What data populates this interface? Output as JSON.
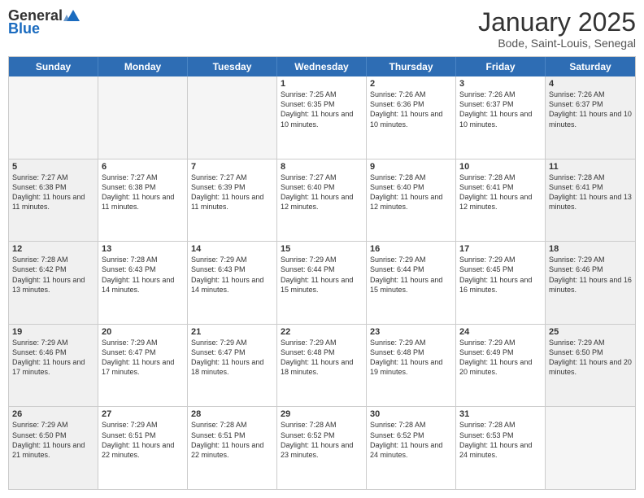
{
  "header": {
    "logo_general": "General",
    "logo_blue": "Blue",
    "month_title": "January 2025",
    "location": "Bode, Saint-Louis, Senegal"
  },
  "days_of_week": [
    "Sunday",
    "Monday",
    "Tuesday",
    "Wednesday",
    "Thursday",
    "Friday",
    "Saturday"
  ],
  "weeks": [
    [
      {
        "day": "",
        "empty": true
      },
      {
        "day": "",
        "empty": true
      },
      {
        "day": "",
        "empty": true
      },
      {
        "day": "1",
        "sunrise": "7:25 AM",
        "sunset": "6:35 PM",
        "daylight": "11 hours and 10 minutes."
      },
      {
        "day": "2",
        "sunrise": "7:26 AM",
        "sunset": "6:36 PM",
        "daylight": "11 hours and 10 minutes."
      },
      {
        "day": "3",
        "sunrise": "7:26 AM",
        "sunset": "6:37 PM",
        "daylight": "11 hours and 10 minutes."
      },
      {
        "day": "4",
        "sunrise": "7:26 AM",
        "sunset": "6:37 PM",
        "daylight": "11 hours and 10 minutes.",
        "shaded": true
      }
    ],
    [
      {
        "day": "5",
        "sunrise": "7:27 AM",
        "sunset": "6:38 PM",
        "daylight": "11 hours and 11 minutes.",
        "shaded": true
      },
      {
        "day": "6",
        "sunrise": "7:27 AM",
        "sunset": "6:38 PM",
        "daylight": "11 hours and 11 minutes."
      },
      {
        "day": "7",
        "sunrise": "7:27 AM",
        "sunset": "6:39 PM",
        "daylight": "11 hours and 11 minutes."
      },
      {
        "day": "8",
        "sunrise": "7:27 AM",
        "sunset": "6:40 PM",
        "daylight": "11 hours and 12 minutes."
      },
      {
        "day": "9",
        "sunrise": "7:28 AM",
        "sunset": "6:40 PM",
        "daylight": "11 hours and 12 minutes."
      },
      {
        "day": "10",
        "sunrise": "7:28 AM",
        "sunset": "6:41 PM",
        "daylight": "11 hours and 12 minutes."
      },
      {
        "day": "11",
        "sunrise": "7:28 AM",
        "sunset": "6:41 PM",
        "daylight": "11 hours and 13 minutes.",
        "shaded": true
      }
    ],
    [
      {
        "day": "12",
        "sunrise": "7:28 AM",
        "sunset": "6:42 PM",
        "daylight": "11 hours and 13 minutes.",
        "shaded": true
      },
      {
        "day": "13",
        "sunrise": "7:28 AM",
        "sunset": "6:43 PM",
        "daylight": "11 hours and 14 minutes."
      },
      {
        "day": "14",
        "sunrise": "7:29 AM",
        "sunset": "6:43 PM",
        "daylight": "11 hours and 14 minutes."
      },
      {
        "day": "15",
        "sunrise": "7:29 AM",
        "sunset": "6:44 PM",
        "daylight": "11 hours and 15 minutes."
      },
      {
        "day": "16",
        "sunrise": "7:29 AM",
        "sunset": "6:44 PM",
        "daylight": "11 hours and 15 minutes."
      },
      {
        "day": "17",
        "sunrise": "7:29 AM",
        "sunset": "6:45 PM",
        "daylight": "11 hours and 16 minutes."
      },
      {
        "day": "18",
        "sunrise": "7:29 AM",
        "sunset": "6:46 PM",
        "daylight": "11 hours and 16 minutes.",
        "shaded": true
      }
    ],
    [
      {
        "day": "19",
        "sunrise": "7:29 AM",
        "sunset": "6:46 PM",
        "daylight": "11 hours and 17 minutes.",
        "shaded": true
      },
      {
        "day": "20",
        "sunrise": "7:29 AM",
        "sunset": "6:47 PM",
        "daylight": "11 hours and 17 minutes."
      },
      {
        "day": "21",
        "sunrise": "7:29 AM",
        "sunset": "6:47 PM",
        "daylight": "11 hours and 18 minutes."
      },
      {
        "day": "22",
        "sunrise": "7:29 AM",
        "sunset": "6:48 PM",
        "daylight": "11 hours and 18 minutes."
      },
      {
        "day": "23",
        "sunrise": "7:29 AM",
        "sunset": "6:48 PM",
        "daylight": "11 hours and 19 minutes."
      },
      {
        "day": "24",
        "sunrise": "7:29 AM",
        "sunset": "6:49 PM",
        "daylight": "11 hours and 20 minutes."
      },
      {
        "day": "25",
        "sunrise": "7:29 AM",
        "sunset": "6:50 PM",
        "daylight": "11 hours and 20 minutes.",
        "shaded": true
      }
    ],
    [
      {
        "day": "26",
        "sunrise": "7:29 AM",
        "sunset": "6:50 PM",
        "daylight": "11 hours and 21 minutes.",
        "shaded": true
      },
      {
        "day": "27",
        "sunrise": "7:29 AM",
        "sunset": "6:51 PM",
        "daylight": "11 hours and 22 minutes."
      },
      {
        "day": "28",
        "sunrise": "7:28 AM",
        "sunset": "6:51 PM",
        "daylight": "11 hours and 22 minutes."
      },
      {
        "day": "29",
        "sunrise": "7:28 AM",
        "sunset": "6:52 PM",
        "daylight": "11 hours and 23 minutes."
      },
      {
        "day": "30",
        "sunrise": "7:28 AM",
        "sunset": "6:52 PM",
        "daylight": "11 hours and 24 minutes."
      },
      {
        "day": "31",
        "sunrise": "7:28 AM",
        "sunset": "6:53 PM",
        "daylight": "11 hours and 24 minutes."
      },
      {
        "day": "",
        "empty": true,
        "shaded": true
      }
    ]
  ]
}
